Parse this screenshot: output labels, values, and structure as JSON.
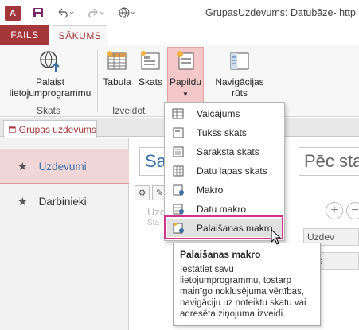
{
  "window": {
    "app_icon_text": "A",
    "title": "GrupasUzdevums: Datubāze- http"
  },
  "quick_access": {
    "save_icon": "save-icon",
    "undo_icon": "undo-icon",
    "redo_icon": "redo-icon",
    "web_icon": "globe-icon"
  },
  "ribbon_tabs": {
    "file": "FAILS",
    "home": "SĀKUMS"
  },
  "ribbon": {
    "launch_app_line1": "Palaist",
    "launch_app_line2": "lietojumprogrammu",
    "group_views": "Skats",
    "table": "Tabula",
    "view": "Skats",
    "advanced": "Papildu",
    "group_create": "Izveidot",
    "nav_line1": "Navigācijas",
    "nav_line2": "rūts"
  },
  "object_tab": {
    "label": "Grupas uzdevums"
  },
  "nav": {
    "items": [
      {
        "label": "Uzdevumi"
      },
      {
        "label": "Darbinieki"
      }
    ]
  },
  "main": {
    "title_partial": "Sara",
    "search_partial": "Pēc sta",
    "ghost_1": "Uzd",
    "ghost_2": "Sta",
    "field_1": "Uzdev",
    "field_2": "Apraks"
  },
  "menu": {
    "items": [
      {
        "label": "Vaicājums",
        "icon": "query-icon"
      },
      {
        "label": "Tukšs skats",
        "icon": "blank-view-icon"
      },
      {
        "label": "Saraksta skats",
        "icon": "list-view-icon"
      },
      {
        "label": "Datu lapas skats",
        "icon": "datasheet-view-icon"
      },
      {
        "label": "Makro",
        "icon": "macro-icon"
      },
      {
        "label": "Datu makro",
        "icon": "data-macro-icon"
      },
      {
        "label": "Palaišanas makro",
        "icon": "on-start-macro-icon"
      }
    ]
  },
  "tooltip": {
    "title": "Palaišanas makro",
    "body": "Iestatiet savu lietojumprogrammu, tostarp mainīgo noklusējuma vērtības, navigāciju uz noteiktu skatu vai adresēta ziņojuma izveidi."
  },
  "colors": {
    "accent": "#a4373a",
    "highlight": "#d0358a",
    "link_blue": "#3a6ea5"
  }
}
